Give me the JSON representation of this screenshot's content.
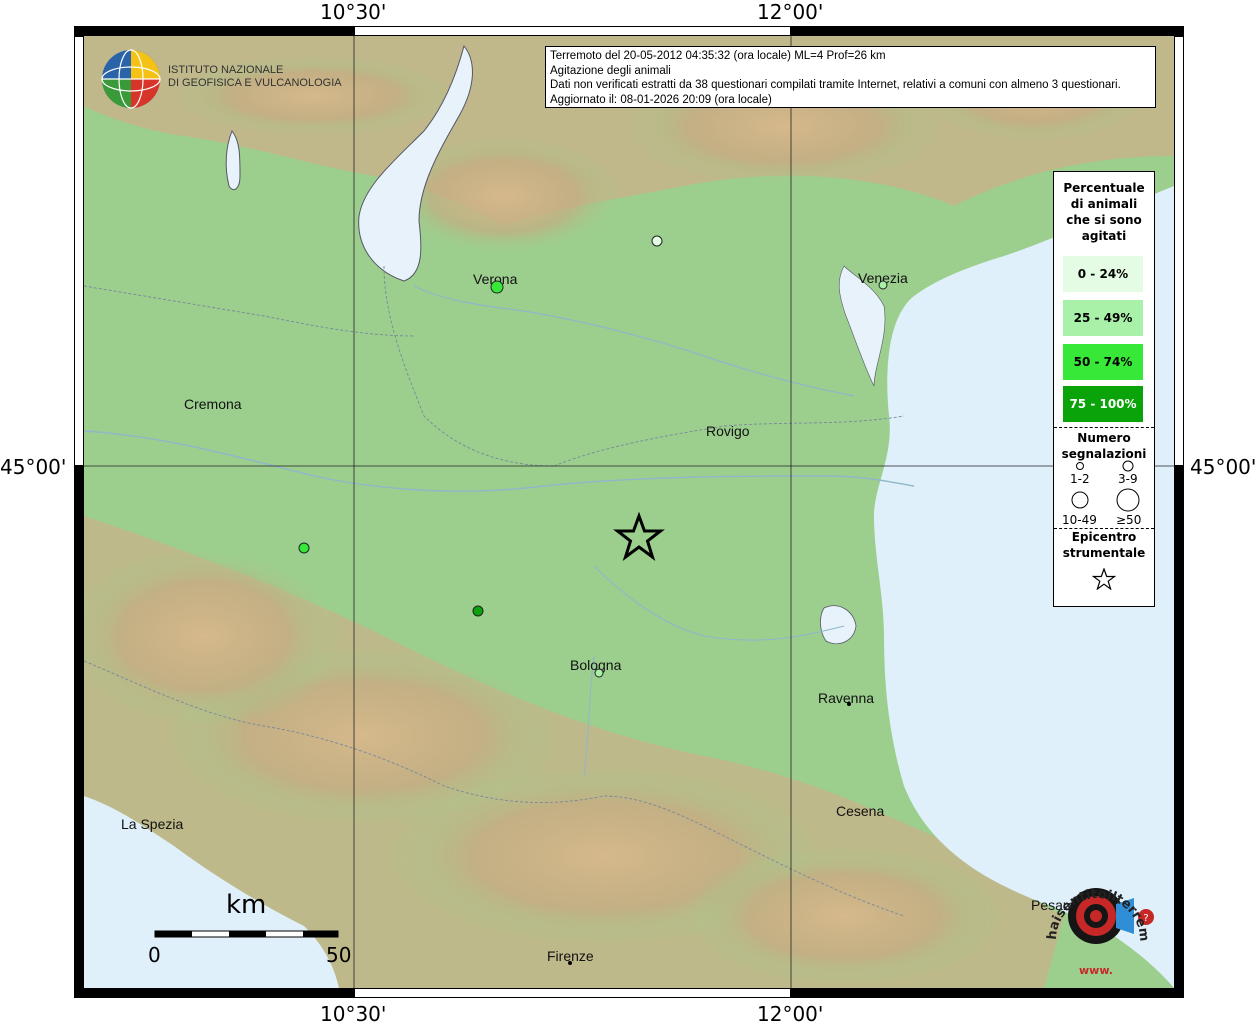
{
  "frame": {
    "lon_labels": [
      "10°30'",
      "12°00'"
    ],
    "lat_label": "45°00'"
  },
  "info": {
    "line1": "Terremoto del 20-05-2012 04:35:32 (ora locale) ML=4 Prof=26 km",
    "line2": "Agitazione degli animali",
    "line3": "Dati non verificati estratti da 38 questionari compilati tramite Internet, relativi a comuni con almeno 3 questionari.",
    "line4": "Aggiornato il: 08-01-2026 20:09 (ora locale)"
  },
  "logo_ingv": {
    "line1": "ISTITUTO NAZIONALE",
    "line2": "DI GEOFISICA E VULCANOLOGIA"
  },
  "logo_hst": {
    "text": "haisentitoilterremoto.it",
    "www": "www."
  },
  "legend": {
    "title": [
      "Percentuale",
      "di animali",
      "che si sono",
      "agitati"
    ],
    "classes": [
      {
        "label": "0 - 24%",
        "color": "#e4fbe4"
      },
      {
        "label": "25 - 49%",
        "color": "#a9f0a9"
      },
      {
        "label": "50 - 74%",
        "color": "#38e838"
      },
      {
        "label": "75 - 100%",
        "color": "#0aa40a"
      }
    ],
    "count_title": [
      "Numero",
      "segnalazioni"
    ],
    "counts": [
      "1-2",
      "3-9",
      "10-49",
      "≥50"
    ],
    "epicenter_title": [
      "Epicentro",
      "strumentale"
    ]
  },
  "cities": [
    "Verona",
    "Venezia",
    "Cremona",
    "Rovigo",
    "Bologna",
    "Ravenna",
    "La Spezia",
    "Cesena",
    "Pesaro",
    "Firenze"
  ],
  "observations": [
    {
      "place": "Verona",
      "class": 2
    },
    {
      "place": "Venezia",
      "class": 1
    },
    {
      "place": "Bologna",
      "class": 1
    },
    {
      "place": "",
      "class": 0
    },
    {
      "place": "",
      "class": 2
    },
    {
      "place": "",
      "class": 3
    }
  ],
  "scalebar": {
    "unit": "km",
    "min": "0",
    "max": "50"
  },
  "colors": {
    "plain": "#9ccf8e",
    "sea": "#dff0fb",
    "lake": "#e8f2fa",
    "relief": "#c9a877",
    "epicenter": "#000000"
  }
}
